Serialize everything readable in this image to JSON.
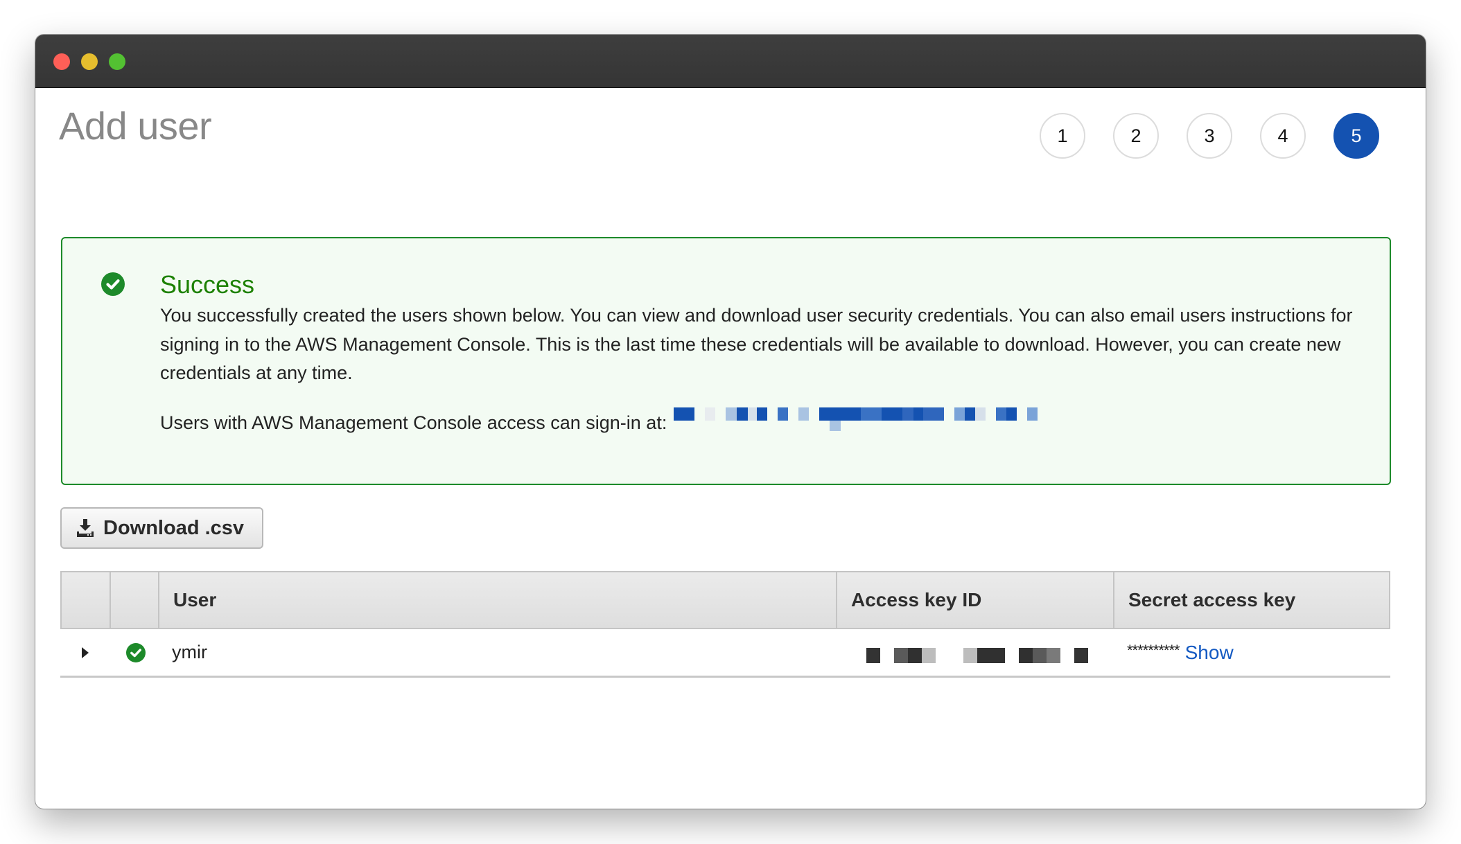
{
  "window": {
    "traffic_lights": [
      "close",
      "minimize",
      "maximize"
    ]
  },
  "page": {
    "title": "Add user"
  },
  "wizard": {
    "steps": [
      {
        "label": "1",
        "active": false
      },
      {
        "label": "2",
        "active": false
      },
      {
        "label": "3",
        "active": false
      },
      {
        "label": "4",
        "active": false
      },
      {
        "label": "5",
        "active": true
      }
    ],
    "current_step": 5,
    "total_steps": 5
  },
  "alert": {
    "type": "success",
    "icon": "check-circle-icon",
    "title": "Success",
    "body": "You successfully created the users shown below. You can view and download user security credentials. You can also email users instructions for signing in to the AWS Management Console. This is the last time these credentials will be available to download. However, you can create new credentials at any time.",
    "signin_label": "Users with AWS Management Console access can sign-in at:",
    "signin_url": "[redacted]"
  },
  "actions": {
    "download_label": "Download .csv",
    "download_icon": "download-icon"
  },
  "table": {
    "columns": [
      "",
      "",
      "User",
      "Access key ID",
      "Secret access key"
    ],
    "rows": [
      {
        "expand_icon": "caret-right-icon",
        "status_icon": "check-circle-icon",
        "user": "ymir",
        "access_key_id": "[redacted]",
        "secret_access_key_mask": "**********",
        "show_label": "Show"
      }
    ]
  },
  "colors": {
    "accent": "#1452b1",
    "success": "#1d8102",
    "link": "#1359c2",
    "alert_bg": "#f3fbf3"
  }
}
